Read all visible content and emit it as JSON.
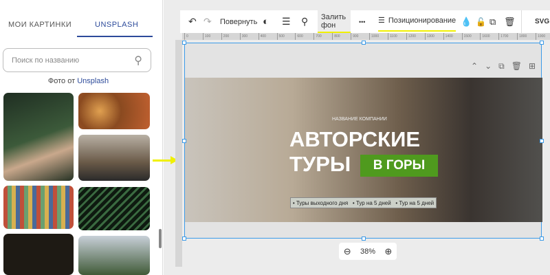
{
  "left_panel": {
    "tabs": [
      {
        "label": "МОИ КАРТИНКИ",
        "active": false
      },
      {
        "label": "UNSPLASH",
        "active": true
      }
    ],
    "search_placeholder": "Поиск по названию",
    "credit_prefix": "Фото от",
    "credit_link": "Unsplash",
    "accent": "#2c4a9a"
  },
  "toolbar": {
    "rotate": "Повернуть",
    "fill_bg": "Залить фон",
    "more": "•••",
    "positioning": "Позиционирование",
    "svg": "SVG"
  },
  "ruler_ticks": [
    "0",
    "100",
    "200",
    "300",
    "400",
    "500",
    "600",
    "700",
    "800",
    "900",
    "1000",
    "1100",
    "1200",
    "1300",
    "1400",
    "1500",
    "1600",
    "1700",
    "1800",
    "1900"
  ],
  "banner": {
    "company": "НАЗВАНИЕ КОМПАНИИ",
    "title_line1": "АВТОРСКИЕ",
    "title_line2": "ТУРЫ",
    "badge": "В ГОРЫ",
    "badge_color": "#4f9a1e",
    "features": "• Туры выходного дня   • Тур на 5 дней   • Тур на 5 дней"
  },
  "zoom": {
    "value": "38%"
  }
}
